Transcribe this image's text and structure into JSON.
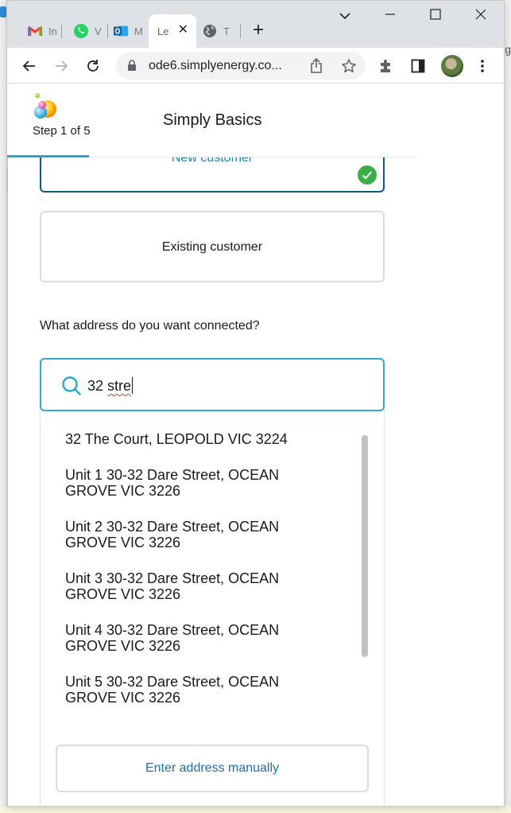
{
  "browser": {
    "tabs": [
      {
        "title": "In",
        "icon": "gmail-icon"
      },
      {
        "title": "V",
        "icon": "whatsapp-icon"
      },
      {
        "title": "M",
        "icon": "outlook-icon"
      },
      {
        "title": "Le",
        "icon": "",
        "active": true
      },
      {
        "title": "T",
        "icon": "globe-icon"
      }
    ],
    "new_tab_label": "+",
    "url": "ode6.simplyenergy.co...",
    "side_glyph": "g"
  },
  "header": {
    "step_text": "Step 1 of 5",
    "title": "Simply Basics",
    "progress_fraction": 0.2
  },
  "customer_choice": {
    "new_label": "New customer",
    "new_selected": true,
    "existing_label": "Existing customer"
  },
  "address": {
    "question": "What address do you want connected?",
    "input_value_plain": "32 ",
    "input_value_squiggled": "stre",
    "results": [
      {
        "line1": "32 The Court, LEOPOLD VIC 3224",
        "line2": ""
      },
      {
        "line1": "Unit 1 30-32 Dare Street, OCEAN",
        "line2": "GROVE VIC 3226"
      },
      {
        "line1": "Unit 2 30-32 Dare Street, OCEAN",
        "line2": "GROVE VIC 3226"
      },
      {
        "line1": "Unit 3 30-32 Dare Street, OCEAN",
        "line2": "GROVE VIC 3226"
      },
      {
        "line1": "Unit 4 30-32 Dare Street, OCEAN",
        "line2": "GROVE VIC 3226"
      },
      {
        "line1": "Unit 5 30-32 Dare Street, OCEAN",
        "line2": "GROVE VIC 3226"
      }
    ],
    "manual_label": "Enter address manually"
  },
  "colors": {
    "accent": "#2aa7c9",
    "selected_border": "#0d5b7a",
    "check": "#3cae49",
    "link": "#1f6fa3"
  }
}
